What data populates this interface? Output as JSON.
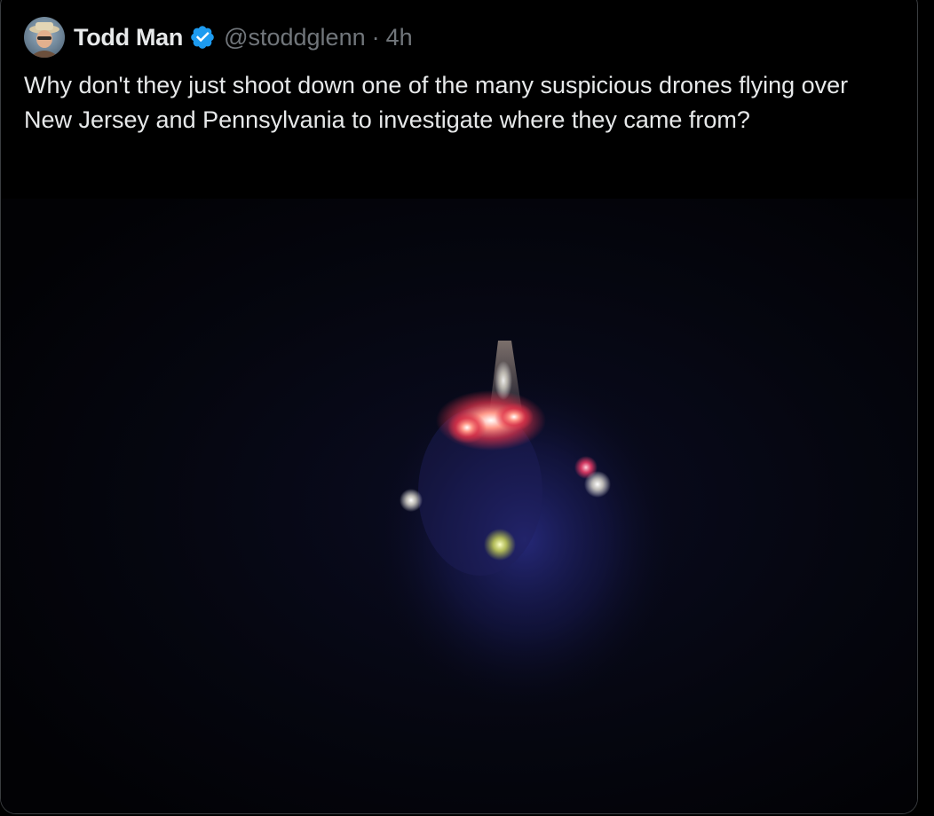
{
  "tweet": {
    "author": {
      "display_name": "Todd Man",
      "handle": "@stoddglenn",
      "verified": true,
      "avatar_icon": "avatar-photo"
    },
    "separator": "·",
    "timestamp": "4h",
    "text": "Why don't they just shoot down one of the many suspicious drones flying over New Jersey and Pennsylvania to investigate where they came from?",
    "media": {
      "type": "photo",
      "subject": "night-sky-lights"
    }
  },
  "colors": {
    "background": "#000000",
    "text_primary": "#e7e9ea",
    "text_secondary": "#71767b",
    "verified_badge": "#1d9bf0",
    "card_border": "#3a3d40"
  },
  "icons": {
    "verified": "verified-badge-icon"
  }
}
